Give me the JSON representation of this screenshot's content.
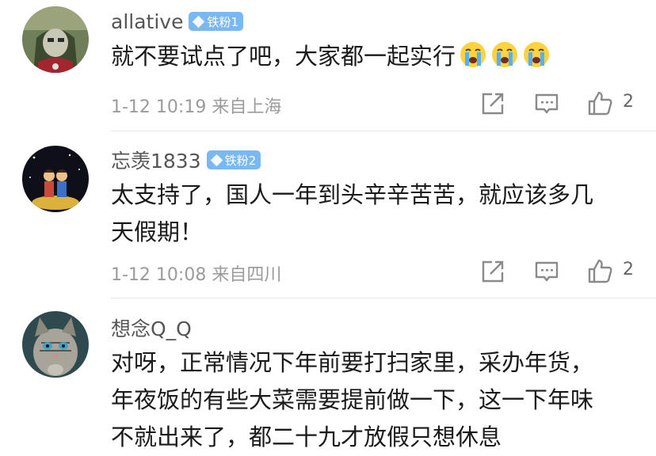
{
  "comments": [
    {
      "username": "allative",
      "badge": "铁粉1",
      "text_lines": [
        "就不要试点了吧，大家都一起实行"
      ],
      "emoji_name": "crying-face-icon",
      "emoji_count": 3,
      "time": "1-12 10:19",
      "location": "来自上海",
      "likes": "2"
    },
    {
      "username": "忘羡1833",
      "badge": "铁粉2",
      "text_lines": [
        "太支持了，国人一年到头辛辛苦苦，就应该多几",
        "天假期！"
      ],
      "time": "1-12 10:08",
      "location": "来自四川",
      "likes": "2"
    },
    {
      "username": "想念Q_Q",
      "text_lines": [
        "对呀，正常情况下年前要打扫家里，采办年货，",
        "年夜饭的有些大菜需要提前做一下，这一下年味",
        "不就出来了，都二十九才放假只想休息"
      ]
    }
  ],
  "icons": {
    "share": "share-icon",
    "reply": "comment-icon",
    "like": "thumbs-up-icon"
  },
  "colors": {
    "badge": "#79b8f2",
    "username": "#555555",
    "meta": "#9b9b9b",
    "text": "#1a1a1a"
  }
}
